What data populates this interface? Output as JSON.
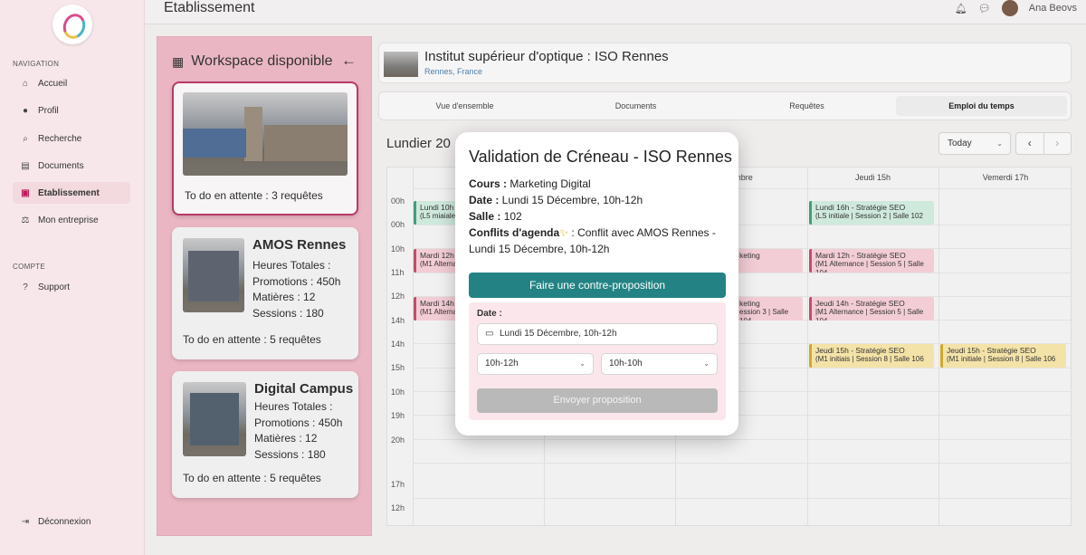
{
  "sidebar": {
    "sections": {
      "navigation": "NAVIGATION",
      "account": "COMPTE"
    },
    "items": [
      {
        "label": "Accueil",
        "icon": "home-icon"
      },
      {
        "label": "Profil",
        "icon": "user-icon"
      },
      {
        "label": "Recherche",
        "icon": "search-icon"
      },
      {
        "label": "Documents",
        "icon": "document-icon"
      },
      {
        "label": "Etablissement",
        "icon": "building-icon",
        "active": true
      },
      {
        "label": "Mon entreprise",
        "icon": "scale-icon"
      }
    ],
    "support": "Support",
    "logout": "Déconnexion"
  },
  "header": {
    "title": "Etablissement",
    "user_name": "Ana Beovs"
  },
  "workspace": {
    "title": "Workspace disponible",
    "cards": [
      {
        "todo": "To do en attente : 3 requêtes"
      },
      {
        "name": "AMOS Rennes",
        "hours": "Heures Totales :",
        "promotions": "Promotions : 450h",
        "subjects": "Matières : 12",
        "sessions": "Sessions : 180",
        "todo": "To do en attente : 5 requêtes"
      },
      {
        "name": "Digital Campus",
        "hours": "Heures Totales :",
        "promotions": "Promotions : 450h",
        "subjects": "Matières : 12",
        "sessions": "Sessions : 180",
        "todo": "To do en attente : 5 requêtes"
      }
    ]
  },
  "institution": {
    "name": "Institut supérieur d'optique : ISO Rennes",
    "location": "Rennes, France"
  },
  "tabs": [
    "Vue d'ensemble",
    "Documents",
    "Requêtes",
    "Emploi du temps"
  ],
  "calendar": {
    "heading": "Lundier 20",
    "today_label": "Today",
    "days": [
      "embre",
      "Jeudi 15h",
      "Vemerdi 17h"
    ],
    "hours": [
      "00h",
      "00h",
      "10h",
      "11h",
      "12h",
      "14h",
      "14h",
      "15h",
      "10h",
      "19h",
      "20h",
      "17h",
      "12h"
    ],
    "events": [
      {
        "title": "Lundi 10h",
        "sub": "(L5 miaiale -"
      },
      {
        "title": "Mardi 12h",
        "sub": "(M1 Alternanc"
      },
      {
        "title": "Mardi 14h",
        "sub": "(M1 Alternanc"
      },
      {
        "title": "keting",
        "sub": ""
      },
      {
        "title": "keting",
        "sub": "ession 3 | Salle 104"
      },
      {
        "title": "Lundi 16h - Stratégie SEO",
        "sub": "(LS initiale | Session 2 | Salle 102"
      },
      {
        "title": "Mardi 12h - Stratégie SEO",
        "sub": "(M1 Alternance | Session 5 | Salle 104"
      },
      {
        "title": "Jeudi 14h - Stratégie SEO",
        "sub": "|M1 Alternance | Session 5 | Salle 104"
      },
      {
        "title": "Jeudi 15h - Stratégie SEO",
        "sub": "(M1 initiais | Session 8 | Salle 106"
      },
      {
        "title": "Jeudi 15h - Stratégie SEO",
        "sub": "(M1 initiale | Session 8 | Salle 106"
      }
    ]
  },
  "modal": {
    "title": "Validation de Créneau - ISO Rennes",
    "course_label": "Cours :",
    "course_value": " Marketing Digital",
    "date_label": "Date :",
    "date_value": " Lundi 15 Décembre, 10h-12h",
    "room_label": "Salle :",
    "room_value": " 102",
    "conflict_label": "Conflits d'agenda",
    "conflict_value": " : Conflit avec AMOS Rennes - Lundi 15 Décembre, 10h-12h",
    "counter_button": "Faire une contre-proposition",
    "form_date_label": "Date :",
    "form_date_value": "Lundi 15 Décembre, 10h-12h",
    "start_select": "10h-12h",
    "end_select": "10h-10h",
    "submit_button": "Envoyer proposition"
  }
}
